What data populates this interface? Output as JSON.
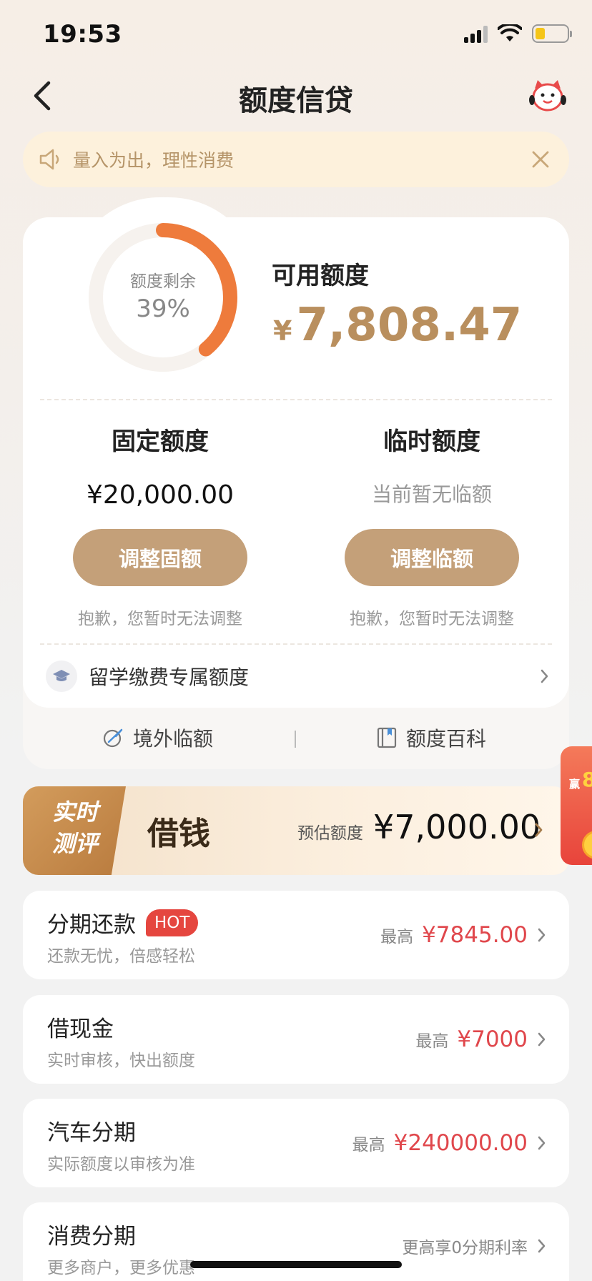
{
  "status_bar": {
    "time": "19:53"
  },
  "nav": {
    "title": "额度信贷"
  },
  "notice": {
    "text": "量入为出，理性消费"
  },
  "credit": {
    "remaining_label": "额度剩余",
    "remaining_percent": "39%",
    "remaining_fraction": 0.39,
    "available_label": "可用额度",
    "available_currency": "¥",
    "available_amount": "7,808.47",
    "fixed": {
      "title": "固定额度",
      "value": "¥20,000.00",
      "button": "调整固额",
      "note": "抱歉，您暂时无法调整"
    },
    "temporary": {
      "title": "临时额度",
      "value": "当前暂无临额",
      "button": "调整临额",
      "note": "抱歉，您暂时无法调整"
    },
    "study_abroad": "留学缴费专属额度",
    "links": {
      "overseas": "境外临额",
      "wiki": "额度百科"
    }
  },
  "loan_banner": {
    "tag_line1": "实时",
    "tag_line2": "测评",
    "title": "借钱",
    "estimate_label": "预估额度",
    "estimate_value": "¥7,000.00"
  },
  "float_badge": {
    "big": "8",
    "text": "赢"
  },
  "products": [
    {
      "title": "分期还款",
      "badge": "HOT",
      "subtitle": "还款无忧，倍感轻松",
      "label": "最高",
      "value": "¥7845.00"
    },
    {
      "title": "借现金",
      "subtitle": "实时审核，快出额度",
      "label": "最高",
      "value": "¥7000"
    },
    {
      "title": "汽车分期",
      "subtitle": "实际额度以审核为准",
      "label": "最高",
      "value": "¥240000.00"
    },
    {
      "title": "消费分期",
      "subtitle": "更多商户，更多优惠",
      "plain": "更高享0分期利率"
    }
  ],
  "colors": {
    "gold": "#c4a079",
    "accent_orange": "#ee7b3c",
    "price_red": "#e0474c",
    "hot_red": "#e5463f"
  }
}
